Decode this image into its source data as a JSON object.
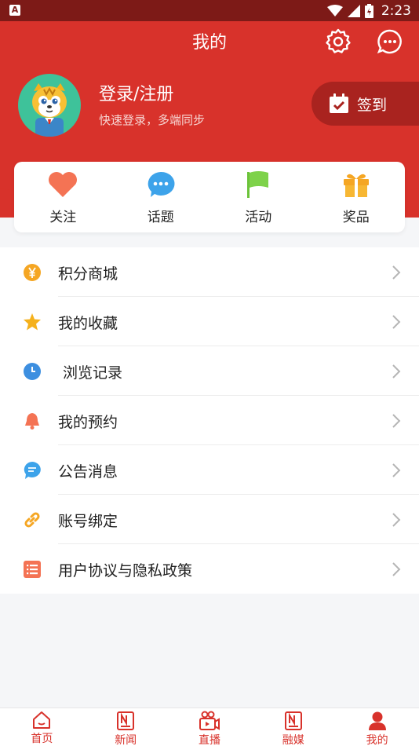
{
  "status_bar": {
    "notification_icon_letter": "A",
    "time": "2:23"
  },
  "header": {
    "title": "我的"
  },
  "profile": {
    "login_title": "登录/注册",
    "login_subtitle": "快速登录，多端同步",
    "checkin_label": "签到"
  },
  "quick_actions": [
    {
      "label": "关注",
      "icon": "heart-icon"
    },
    {
      "label": "话题",
      "icon": "chat-bubble-icon"
    },
    {
      "label": "活动",
      "icon": "flag-icon"
    },
    {
      "label": "奖品",
      "icon": "gift-icon"
    }
  ],
  "menu": [
    {
      "label": "积分商城",
      "icon": "yen-coin-icon"
    },
    {
      "label": "我的收藏",
      "icon": "star-icon"
    },
    {
      "label": "浏览记录",
      "icon": "clock-icon"
    },
    {
      "label": "我的预约",
      "icon": "bell-icon"
    },
    {
      "label": "公告消息",
      "icon": "message-icon"
    },
    {
      "label": "账号绑定",
      "icon": "link-icon"
    },
    {
      "label": "用户协议与隐私政策",
      "icon": "list-icon"
    }
  ],
  "tabs": [
    {
      "label": "首页",
      "icon": "home-icon"
    },
    {
      "label": "新闻",
      "icon": "news-icon"
    },
    {
      "label": "直播",
      "icon": "video-camera-icon"
    },
    {
      "label": "融媒",
      "icon": "media-icon"
    },
    {
      "label": "我的",
      "icon": "user-icon",
      "active": true
    }
  ],
  "colors": {
    "primary": "#d8322b",
    "checkin_bg": "#a9231f",
    "status_bar": "#7d1a17"
  }
}
